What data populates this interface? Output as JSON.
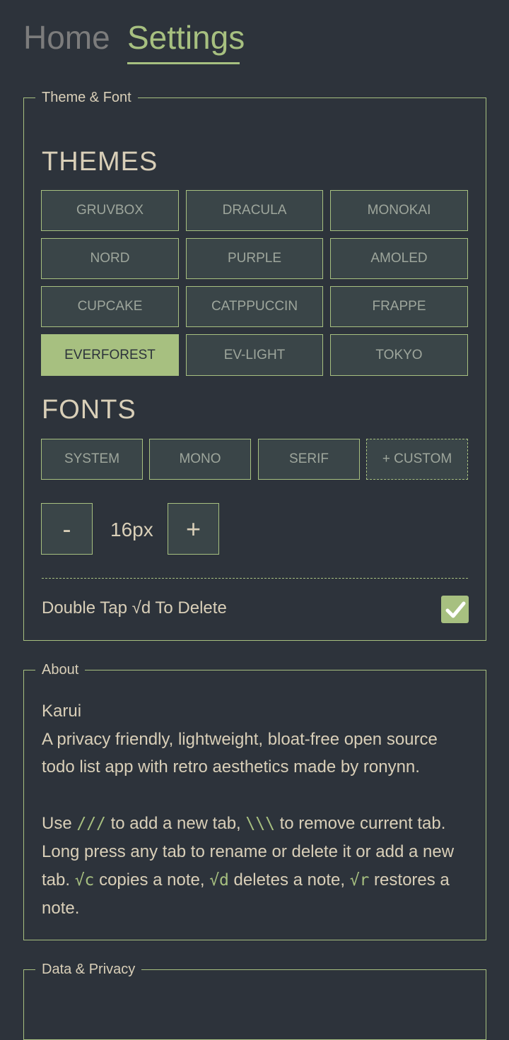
{
  "tabs": [
    {
      "label": "Home",
      "active": false
    },
    {
      "label": "Settings",
      "active": true
    }
  ],
  "theme_font": {
    "legend": "Theme & Font",
    "themes_heading": "THEMES",
    "themes": [
      "GRUVBOX",
      "DRACULA",
      "MONOKAI",
      "NORD",
      "PURPLE",
      "AMOLED",
      "CUPCAKE",
      "CATPPUCCIN",
      "FRAPPE",
      "EVERFOREST",
      "EV-LIGHT",
      "TOKYO"
    ],
    "selected_theme": "EVERFOREST",
    "fonts_heading": "FONTS",
    "fonts": [
      "SYSTEM",
      "MONO",
      "SERIF",
      "+ CUSTOM"
    ],
    "font_size": {
      "decrease": "-",
      "value": "16px",
      "increase": "+"
    },
    "double_tap": {
      "label": "Double Tap √d To Delete",
      "checked": true
    }
  },
  "about": {
    "legend": "About",
    "app_name": "Karui",
    "description": "A privacy friendly, lightweight, bloat-free open source todo list app with retro aesthetics made by ronynn.",
    "usage": {
      "t1": "Use ",
      "c1": "///",
      "t2": " to add a new tab, ",
      "c2": "\\\\\\",
      "t3": " to remove current tab. Long press any tab to rename or delete it or add a new tab. ",
      "c3": "√c",
      "t4": " copies a note, ",
      "c4": "√d",
      "t5": " deletes a note, ",
      "c5": "√r",
      "t6": " restores a note."
    }
  },
  "next_section": {
    "legend": "Data & Privacy"
  },
  "colors": {
    "background": "#2d333b",
    "accent": "#a7c080",
    "text": "#d9cfb8",
    "button_bg": "#3a4548",
    "muted": "#7c7c7c"
  }
}
